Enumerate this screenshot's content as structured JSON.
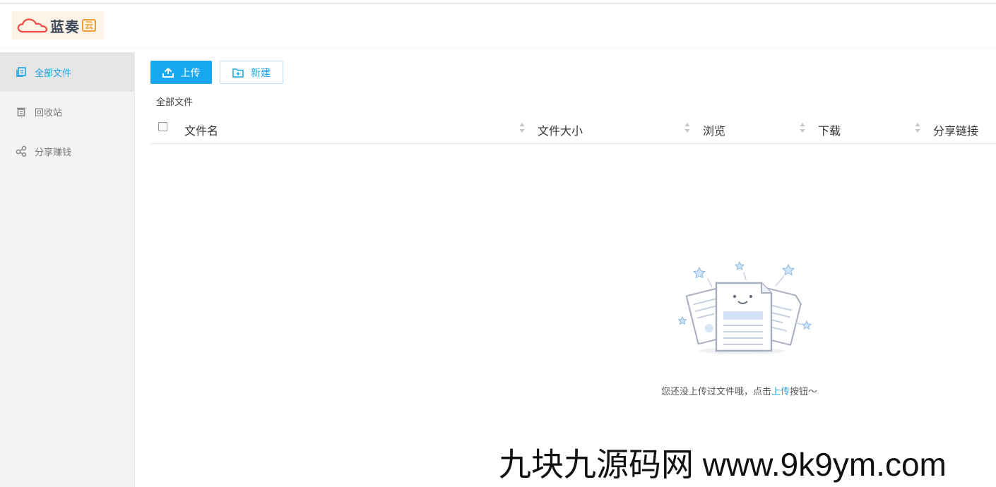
{
  "header": {
    "logo_text": "蓝奏",
    "logo_badge": "云"
  },
  "sidebar": {
    "items": [
      {
        "label": "全部文件",
        "icon": "files-icon",
        "active": true
      },
      {
        "label": "回收站",
        "icon": "trash-icon",
        "active": false
      },
      {
        "label": "分享赚钱",
        "icon": "share-icon",
        "active": false
      }
    ]
  },
  "toolbar": {
    "upload_label": "上传",
    "new_label": "新建"
  },
  "breadcrumb": "全部文件",
  "table": {
    "columns": [
      "文件名",
      "文件大小",
      "浏览",
      "下载",
      "分享链接"
    ]
  },
  "empty": {
    "text_before": "您还没上传过文件哦，点击",
    "link": "上传",
    "text_after": "按钮～"
  },
  "watermark": "九块九源码网 www.9k9ym.com",
  "colors": {
    "accent": "#18a8f1",
    "sidebar_bg": "#f4f4f4"
  }
}
